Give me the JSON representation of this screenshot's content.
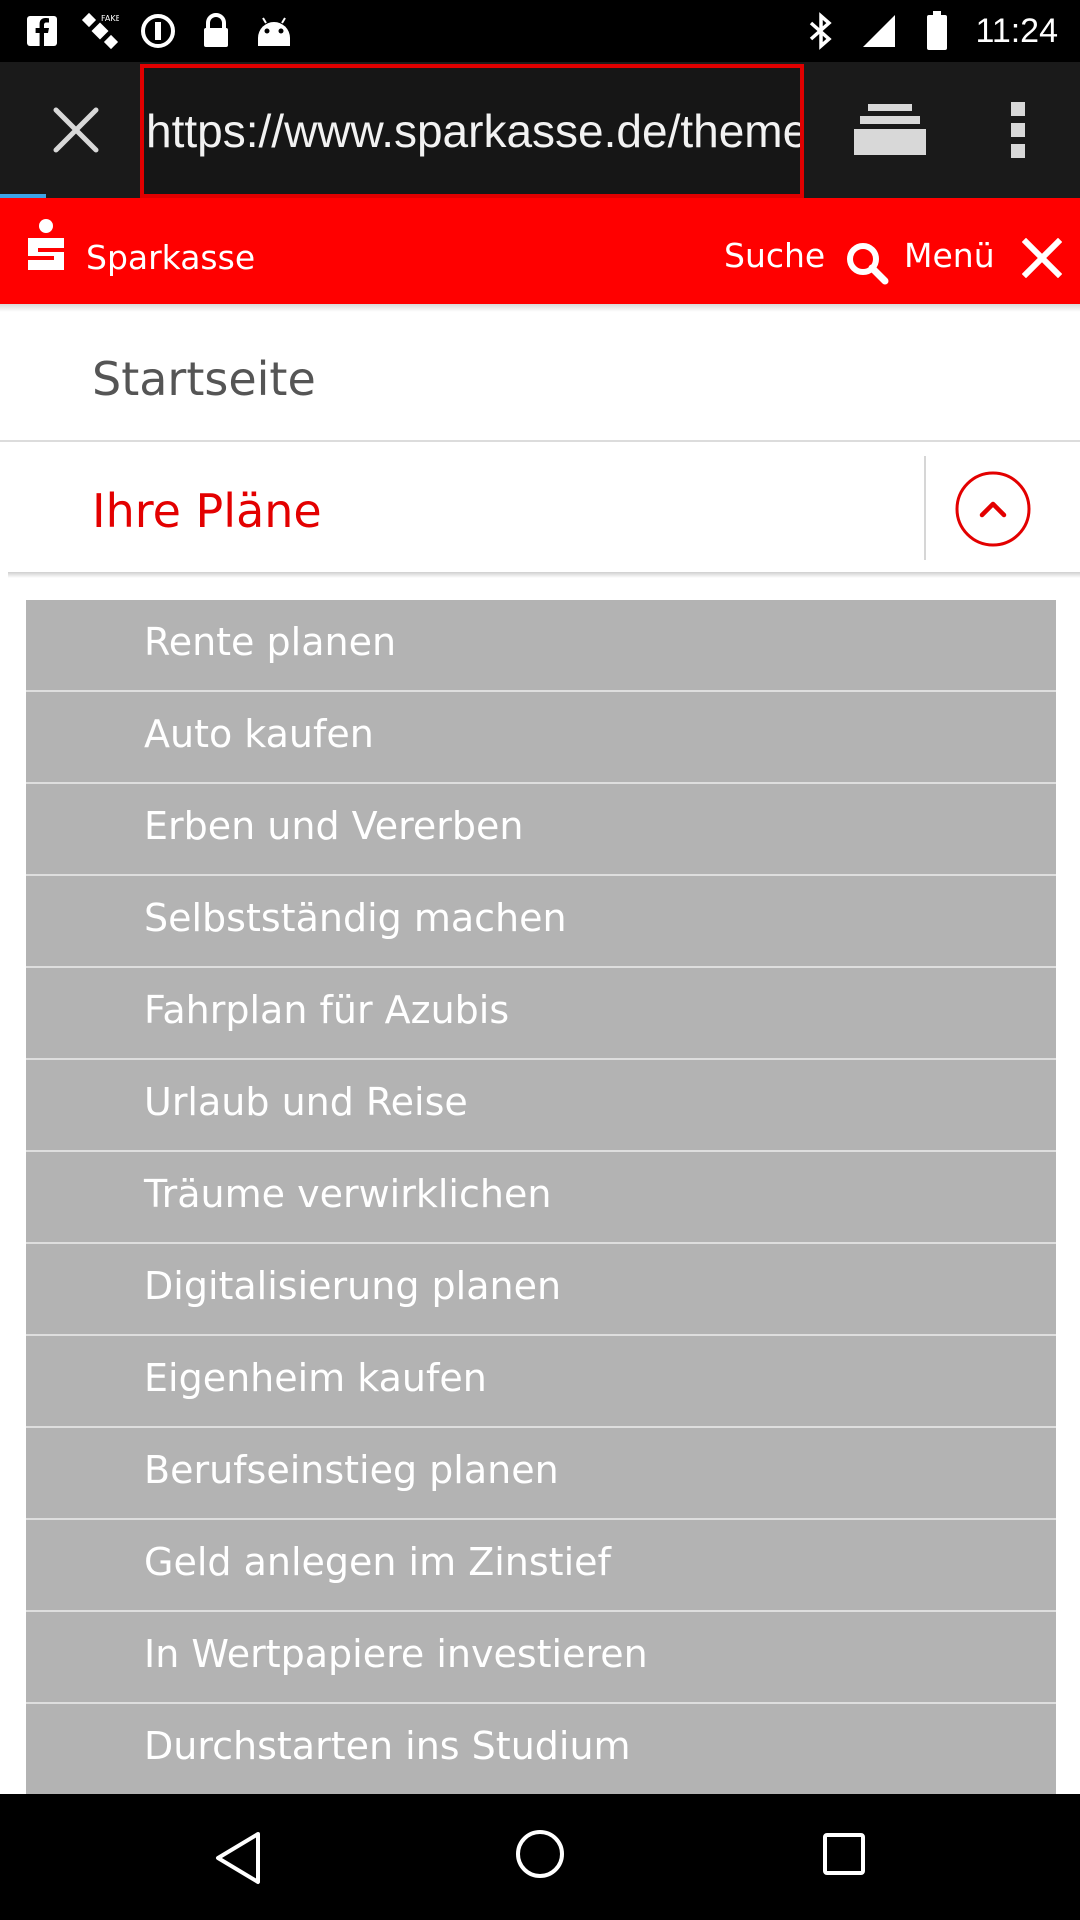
{
  "status_bar": {
    "time": "11:24",
    "left_icons": [
      "facebook-icon",
      "satellite-fake-gps-icon",
      "alarm-info-icon",
      "lock-icon",
      "android-icon"
    ],
    "right_icons": [
      "bluetooth-icon",
      "signal-icon",
      "battery-icon"
    ]
  },
  "browser": {
    "url": "https://www.sparkasse.de/themen",
    "colors": {
      "toolbar": "#1a1a1a",
      "url_border": "#e00000",
      "progress": "#3ba3e6"
    }
  },
  "site_header": {
    "brand": "Sparkasse",
    "search_label": "Suche",
    "menu_label": "Menü",
    "colors": {
      "background": "#ff0000"
    }
  },
  "nav": {
    "start_label": "Startseite",
    "plans_label": "Ihre Pläne"
  },
  "submenu": {
    "items": [
      "Rente planen",
      "Auto kaufen",
      "Erben und Vererben",
      "Selbstständig machen",
      "Fahrplan für Azubis",
      "Urlaub und Reise",
      "Träume verwirklichen",
      "Digitalisierung planen",
      "Eigenheim kaufen",
      "Berufseinstieg planen",
      "Geld anlegen im Zinstief",
      "In Wertpapiere investieren",
      "Durchstarten ins Studium"
    ],
    "colors": {
      "background": "#b3b3b3"
    }
  },
  "system_nav": {
    "icons": [
      "back-icon",
      "home-icon",
      "recents-icon"
    ]
  }
}
